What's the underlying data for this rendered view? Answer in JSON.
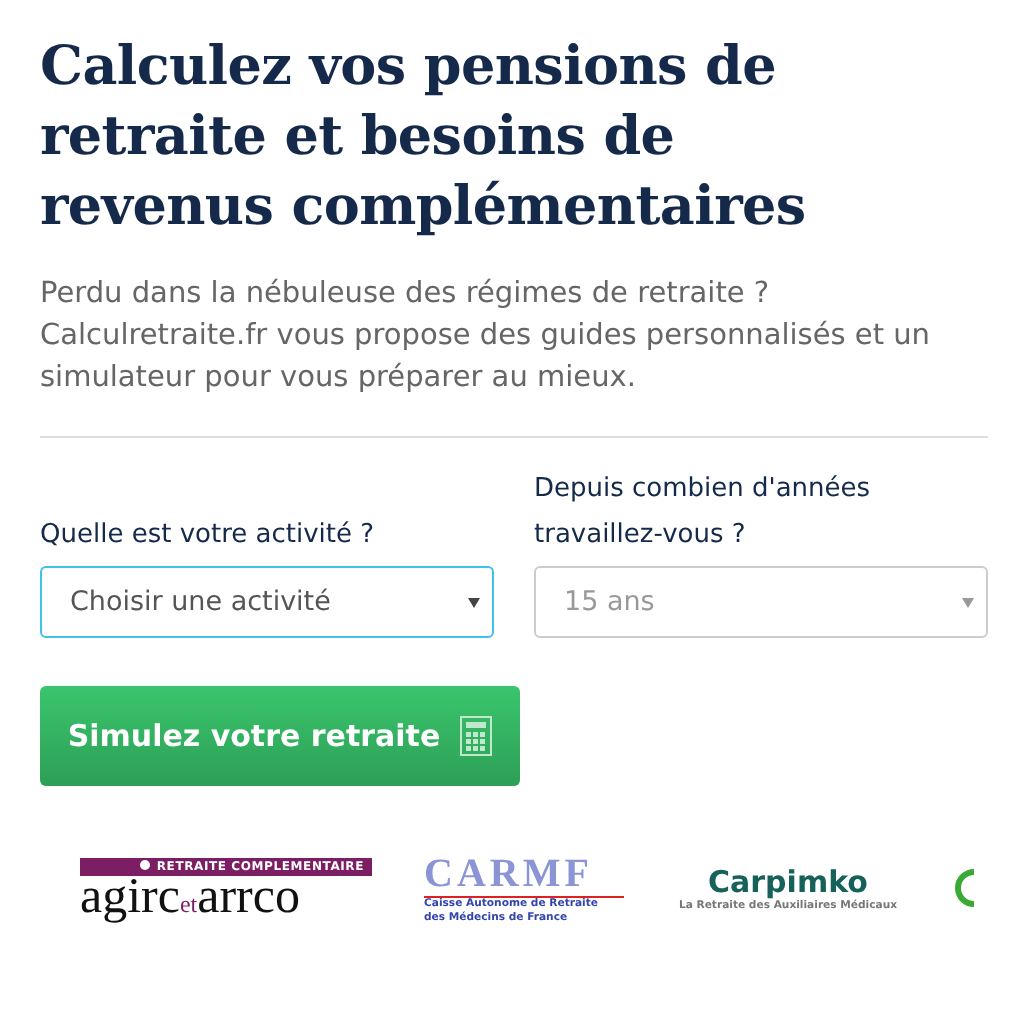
{
  "heading": "Calculez vos pensions de retraite et besoins de revenus complémentaires",
  "intro": "Perdu dans la nébuleuse des régimes de retraite ? Calculretraite.fr vous propose des guides personnalisés et un simulateur pour vous préparer au mieux.",
  "form": {
    "fields": [
      {
        "label": "Quelle est votre activité ?",
        "value": "Choisir une activité",
        "focused": true,
        "disabled": false
      },
      {
        "label": "Depuis combien d'années travaillez-vous ?",
        "value": "15 ans",
        "focused": false,
        "disabled": true
      }
    ],
    "submit": "Simulez votre retraite"
  },
  "logos": [
    {
      "kind": "agirc",
      "banner": "RETRAITE COMPLEMENTAIRE",
      "left": "agirc",
      "middle": "et",
      "right": "arrco"
    },
    {
      "kind": "carmf",
      "name": "CARMF",
      "line_1": "Caisse Autonome de Retraite",
      "line_2": "des Médecins de France"
    },
    {
      "kind": "carpimko",
      "name": "Carpimko",
      "tagline": "La Retraite des Auxiliaires Médicaux"
    },
    {
      "kind": "partial"
    }
  ]
}
